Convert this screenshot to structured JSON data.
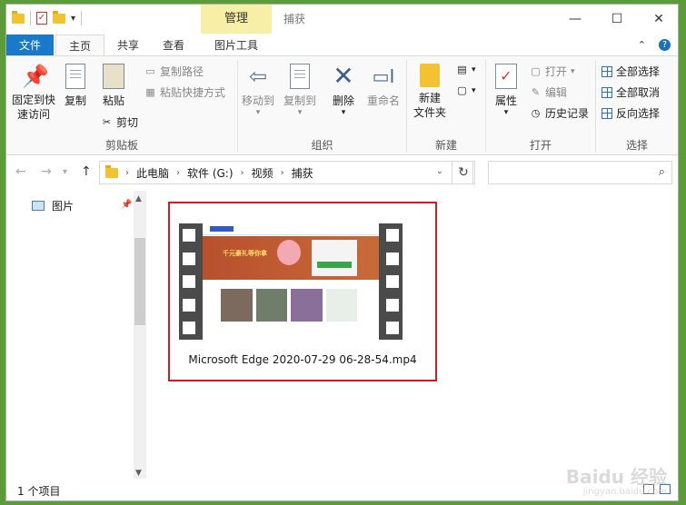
{
  "title_bar": {
    "context_tab": "管理",
    "window_title": "捕获",
    "minimize": "—",
    "maximize": "☐",
    "close": "✕"
  },
  "tabs": [
    {
      "label": "文件"
    },
    {
      "label": "主页"
    },
    {
      "label": "共享"
    },
    {
      "label": "查看"
    },
    {
      "label": "图片工具"
    }
  ],
  "ribbon": {
    "clipboard": {
      "label": "剪贴板",
      "pin_quick": "固定到快\n速访问",
      "copy": "复制",
      "paste": "粘贴",
      "copy_path": "复制路径",
      "paste_shortcut": "粘贴快捷方式",
      "cut": "剪切"
    },
    "organize": {
      "label": "组织",
      "move_to": "移动到",
      "copy_to": "复制到",
      "delete": "删除",
      "rename": "重命名"
    },
    "new": {
      "label": "新建",
      "new_folder": "新建\n文件夹"
    },
    "open": {
      "label": "打开",
      "properties": "属性",
      "open": "打开",
      "edit": "编辑",
      "history": "历史记录"
    },
    "select": {
      "label": "选择",
      "select_all": "全部选择",
      "select_none": "全部取消",
      "invert": "反向选择"
    }
  },
  "address": {
    "crumbs": [
      "此电脑",
      "软件 (G:)",
      "视频",
      "捕获"
    ]
  },
  "nav_pane": {
    "items": [
      {
        "label": "图片"
      }
    ]
  },
  "files": [
    {
      "name": "Microsoft Edge 2020-07-29 06-28-54.mp4"
    }
  ],
  "status": {
    "count": "1 个项目"
  },
  "watermark": {
    "text": "Baidu 经验",
    "url": "jingyan.baidu.com"
  }
}
